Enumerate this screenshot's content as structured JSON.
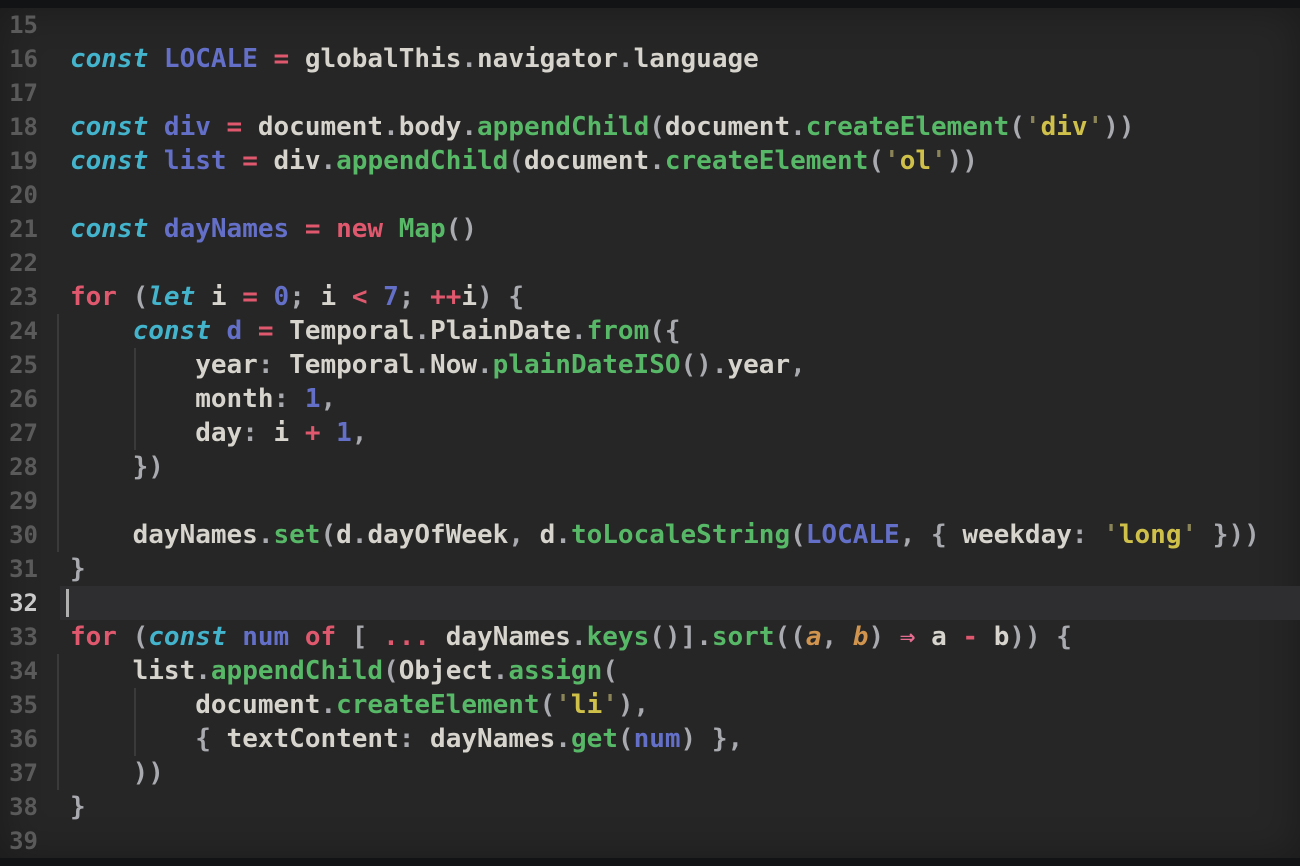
{
  "editor": {
    "language": "javascript",
    "current_line": "32",
    "first_line": "15",
    "last_line": "39",
    "palette": {
      "bg": "#262626",
      "hl": "#2e2e30",
      "caret": "#b0b0b0",
      "guide": "#3a3a3a",
      "ln": "#5a5a5a",
      "lncur": "#cacaca",
      "k": "#43b4cc",
      "v": "#6470c8",
      "n": "#6470c8",
      "o": "#e0586e",
      "r": "#e66d90",
      "f": "#57b867",
      "s": "#cfc04a",
      "q": "#8a8458",
      "t": "#d6d4cd",
      "p": "#a9aab0",
      "a": "#d0944e"
    },
    "lines": [
      {
        "n": "15",
        "guides": [],
        "tokens": []
      },
      {
        "n": "16",
        "guides": [],
        "tokens": [
          [
            "k",
            "const "
          ],
          [
            "v",
            "LOCALE "
          ],
          [
            "o",
            "= "
          ],
          [
            "t",
            "globalThis"
          ],
          [
            "p",
            "."
          ],
          [
            "t",
            "navigator"
          ],
          [
            "p",
            "."
          ],
          [
            "t",
            "language"
          ]
        ]
      },
      {
        "n": "17",
        "guides": [],
        "tokens": []
      },
      {
        "n": "18",
        "guides": [],
        "tokens": [
          [
            "k",
            "const "
          ],
          [
            "v",
            "div "
          ],
          [
            "o",
            "= "
          ],
          [
            "t",
            "document"
          ],
          [
            "p",
            "."
          ],
          [
            "t",
            "body"
          ],
          [
            "p",
            "."
          ],
          [
            "f",
            "appendChild"
          ],
          [
            "p",
            "("
          ],
          [
            "t",
            "document"
          ],
          [
            "p",
            "."
          ],
          [
            "f",
            "createElement"
          ],
          [
            "p",
            "("
          ],
          [
            "q",
            "'"
          ],
          [
            "s",
            "div"
          ],
          [
            "q",
            "'"
          ],
          [
            "p",
            "))"
          ]
        ]
      },
      {
        "n": "19",
        "guides": [],
        "tokens": [
          [
            "k",
            "const "
          ],
          [
            "v",
            "list "
          ],
          [
            "o",
            "= "
          ],
          [
            "t",
            "div"
          ],
          [
            "p",
            "."
          ],
          [
            "f",
            "appendChild"
          ],
          [
            "p",
            "("
          ],
          [
            "t",
            "document"
          ],
          [
            "p",
            "."
          ],
          [
            "f",
            "createElement"
          ],
          [
            "p",
            "("
          ],
          [
            "q",
            "'"
          ],
          [
            "s",
            "ol"
          ],
          [
            "q",
            "'"
          ],
          [
            "p",
            "))"
          ]
        ]
      },
      {
        "n": "20",
        "guides": [],
        "tokens": []
      },
      {
        "n": "21",
        "guides": [],
        "tokens": [
          [
            "k",
            "const "
          ],
          [
            "v",
            "dayNames "
          ],
          [
            "o",
            "= new "
          ],
          [
            "f",
            "Map"
          ],
          [
            "p",
            "()"
          ]
        ]
      },
      {
        "n": "22",
        "guides": [],
        "tokens": []
      },
      {
        "n": "23",
        "guides": [],
        "tokens": [
          [
            "o",
            "for "
          ],
          [
            "p",
            "("
          ],
          [
            "k",
            "let "
          ],
          [
            "t",
            "i "
          ],
          [
            "o",
            "= "
          ],
          [
            "n",
            "0"
          ],
          [
            "p",
            "; "
          ],
          [
            "t",
            "i "
          ],
          [
            "o",
            "< "
          ],
          [
            "n",
            "7"
          ],
          [
            "p",
            "; "
          ],
          [
            "o",
            "++"
          ],
          [
            "t",
            "i"
          ],
          [
            "p",
            ") {"
          ]
        ]
      },
      {
        "n": "24",
        "guides": [
          0
        ],
        "tokens": [
          [
            "t",
            "    "
          ],
          [
            "k",
            "const "
          ],
          [
            "v",
            "d "
          ],
          [
            "o",
            "= "
          ],
          [
            "t",
            "Temporal"
          ],
          [
            "p",
            "."
          ],
          [
            "t",
            "PlainDate"
          ],
          [
            "p",
            "."
          ],
          [
            "f",
            "from"
          ],
          [
            "p",
            "({"
          ]
        ]
      },
      {
        "n": "25",
        "guides": [
          0,
          1
        ],
        "tokens": [
          [
            "t",
            "        year"
          ],
          [
            "p",
            ": "
          ],
          [
            "t",
            "Temporal"
          ],
          [
            "p",
            "."
          ],
          [
            "t",
            "Now"
          ],
          [
            "p",
            "."
          ],
          [
            "f",
            "plainDateISO"
          ],
          [
            "p",
            "()."
          ],
          [
            "t",
            "year"
          ],
          [
            "p",
            ","
          ]
        ]
      },
      {
        "n": "26",
        "guides": [
          0,
          1
        ],
        "tokens": [
          [
            "t",
            "        month"
          ],
          [
            "p",
            ": "
          ],
          [
            "n",
            "1"
          ],
          [
            "p",
            ","
          ]
        ]
      },
      {
        "n": "27",
        "guides": [
          0,
          1
        ],
        "tokens": [
          [
            "t",
            "        day"
          ],
          [
            "p",
            ": "
          ],
          [
            "t",
            "i "
          ],
          [
            "o",
            "+ "
          ],
          [
            "n",
            "1"
          ],
          [
            "p",
            ","
          ]
        ]
      },
      {
        "n": "28",
        "guides": [
          0
        ],
        "tokens": [
          [
            "t",
            "    "
          ],
          [
            "p",
            "})"
          ]
        ]
      },
      {
        "n": "29",
        "guides": [
          0
        ],
        "tokens": []
      },
      {
        "n": "30",
        "guides": [
          0
        ],
        "tokens": [
          [
            "t",
            "    dayNames"
          ],
          [
            "p",
            "."
          ],
          [
            "f",
            "set"
          ],
          [
            "p",
            "("
          ],
          [
            "t",
            "d"
          ],
          [
            "p",
            "."
          ],
          [
            "t",
            "dayOfWeek"
          ],
          [
            "p",
            ", "
          ],
          [
            "t",
            "d"
          ],
          [
            "p",
            "."
          ],
          [
            "f",
            "toLocaleString"
          ],
          [
            "p",
            "("
          ],
          [
            "v",
            "LOCALE"
          ],
          [
            "p",
            ", { "
          ],
          [
            "t",
            "weekday"
          ],
          [
            "p",
            ": "
          ],
          [
            "q",
            "'"
          ],
          [
            "s",
            "long"
          ],
          [
            "q",
            "'"
          ],
          [
            "p",
            " }))"
          ]
        ]
      },
      {
        "n": "31",
        "guides": [],
        "tokens": [
          [
            "p",
            "}"
          ]
        ]
      },
      {
        "n": "32",
        "guides": [],
        "tokens": []
      },
      {
        "n": "33",
        "guides": [],
        "tokens": [
          [
            "o",
            "for "
          ],
          [
            "p",
            "("
          ],
          [
            "k",
            "const "
          ],
          [
            "v",
            "num "
          ],
          [
            "o",
            "of "
          ],
          [
            "p",
            "[ "
          ],
          [
            "o",
            "... "
          ],
          [
            "t",
            "dayNames"
          ],
          [
            "p",
            "."
          ],
          [
            "f",
            "keys"
          ],
          [
            "p",
            "()]."
          ],
          [
            "f",
            "sort"
          ],
          [
            "p",
            "(("
          ],
          [
            "a",
            "a"
          ],
          [
            "p",
            ", "
          ],
          [
            "a",
            "b"
          ],
          [
            "p",
            ") "
          ],
          [
            "r",
            "⇒ "
          ],
          [
            "t",
            "a "
          ],
          [
            "o",
            "- "
          ],
          [
            "t",
            "b"
          ],
          [
            "p",
            ")) {"
          ]
        ]
      },
      {
        "n": "34",
        "guides": [
          0
        ],
        "tokens": [
          [
            "t",
            "    list"
          ],
          [
            "p",
            "."
          ],
          [
            "f",
            "appendChild"
          ],
          [
            "p",
            "("
          ],
          [
            "t",
            "Object"
          ],
          [
            "p",
            "."
          ],
          [
            "f",
            "assign"
          ],
          [
            "p",
            "("
          ]
        ]
      },
      {
        "n": "35",
        "guides": [
          0,
          1
        ],
        "tokens": [
          [
            "t",
            "        document"
          ],
          [
            "p",
            "."
          ],
          [
            "f",
            "createElement"
          ],
          [
            "p",
            "("
          ],
          [
            "q",
            "'"
          ],
          [
            "s",
            "li"
          ],
          [
            "q",
            "'"
          ],
          [
            "p",
            "),"
          ]
        ]
      },
      {
        "n": "36",
        "guides": [
          0,
          1
        ],
        "tokens": [
          [
            "t",
            "        "
          ],
          [
            "p",
            "{ "
          ],
          [
            "t",
            "textContent"
          ],
          [
            "p",
            ": "
          ],
          [
            "t",
            "dayNames"
          ],
          [
            "p",
            "."
          ],
          [
            "f",
            "get"
          ],
          [
            "p",
            "("
          ],
          [
            "v",
            "num"
          ],
          [
            "p",
            ") },"
          ]
        ]
      },
      {
        "n": "37",
        "guides": [
          0
        ],
        "tokens": [
          [
            "t",
            "    "
          ],
          [
            "p",
            "))"
          ]
        ]
      },
      {
        "n": "38",
        "guides": [],
        "tokens": [
          [
            "p",
            "}"
          ]
        ]
      },
      {
        "n": "39",
        "guides": [],
        "tokens": []
      }
    ]
  }
}
